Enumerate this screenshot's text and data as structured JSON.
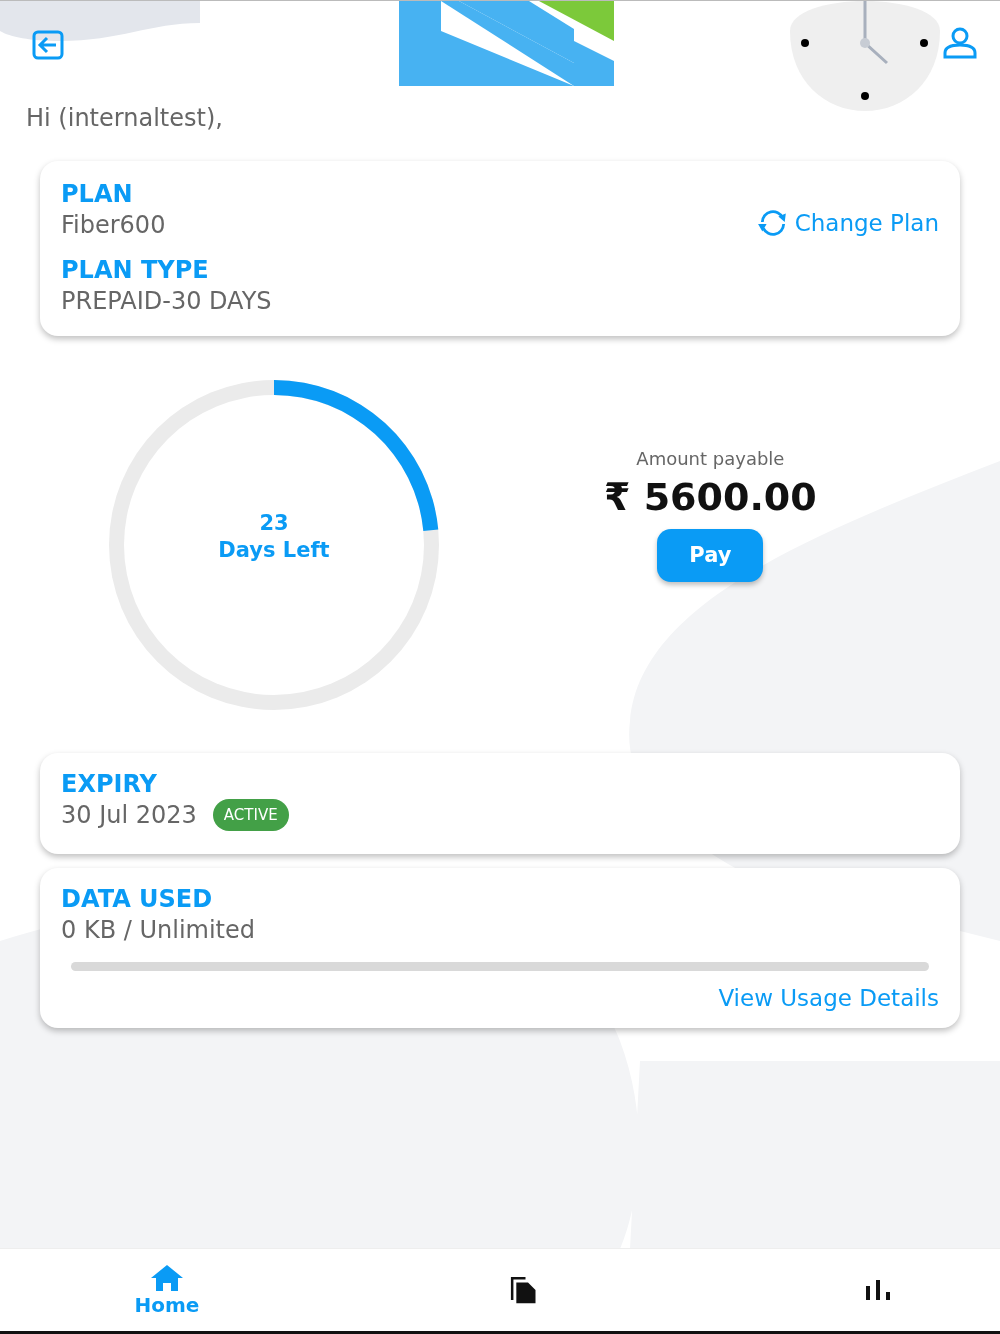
{
  "greeting": "Hi (internaltest),",
  "plan": {
    "plan_label": "PLAN",
    "plan_name": "Fiber600",
    "type_label": "PLAN TYPE",
    "type_value": "PREPAID-30 DAYS",
    "change_link": "Change Plan"
  },
  "days": {
    "count": "23",
    "label": "Days Left"
  },
  "payment": {
    "label": "Amount payable",
    "amount": "₹ 5600.00",
    "button": "Pay"
  },
  "expiry": {
    "label": "EXPIRY",
    "date": "30 Jul 2023",
    "status": "ACTIVE",
    "color": "#43a047"
  },
  "data_used": {
    "label": "DATA USED",
    "value": "0 KB / Unlimited",
    "level": 0,
    "link": "View Usage Details"
  },
  "nav": [
    {
      "kind": "home",
      "label": "Home",
      "selected": true
    },
    {
      "kind": "documents",
      "selected": false
    },
    {
      "kind": "chart",
      "selected": false
    }
  ]
}
